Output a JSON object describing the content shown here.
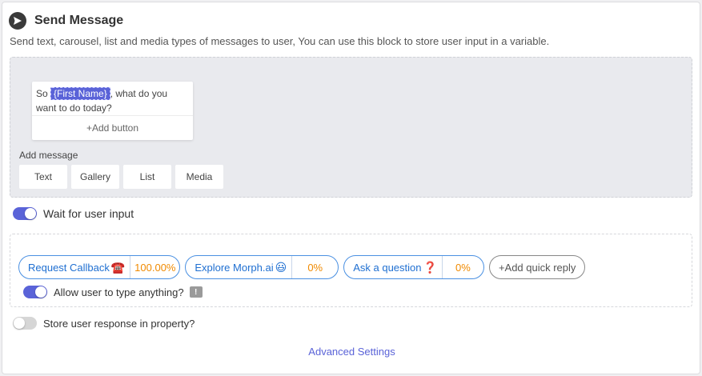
{
  "header": {
    "title": "Send Message",
    "icon": "paper-plane-icon",
    "description": "Send text, carousel, list and media types of messages to user, You can use this block to store user input in a variable."
  },
  "message_card": {
    "text_before": "So ",
    "tag": "{First Name}",
    "text_after": ", what do you want to do today?",
    "add_button_label": "+Add button"
  },
  "add_message": {
    "label": "Add message",
    "types": [
      "Text",
      "Gallery",
      "List",
      "Media"
    ]
  },
  "wait_for_input": {
    "label": "Wait for user input",
    "enabled": true
  },
  "quick_replies": {
    "items": [
      {
        "label": "Request Callback",
        "emoji": "☎️",
        "percent": "100.00%"
      },
      {
        "label": "Explore Morph.ai",
        "emoji": "😃",
        "percent": "0%"
      },
      {
        "label": "Ask a question",
        "emoji": "❓",
        "percent": "0%"
      }
    ],
    "add_label": "+Add quick reply"
  },
  "allow_typing": {
    "label": "Allow user to type anything?",
    "enabled": true,
    "icon": "comment-exclamation-icon"
  },
  "store_response": {
    "label": "Store user response in property?",
    "enabled": false
  },
  "advanced_settings_label": "Advanced Settings",
  "colors": {
    "accent": "#5a63d8",
    "chip_border": "#4a90e2",
    "percent": "#f08a00"
  }
}
